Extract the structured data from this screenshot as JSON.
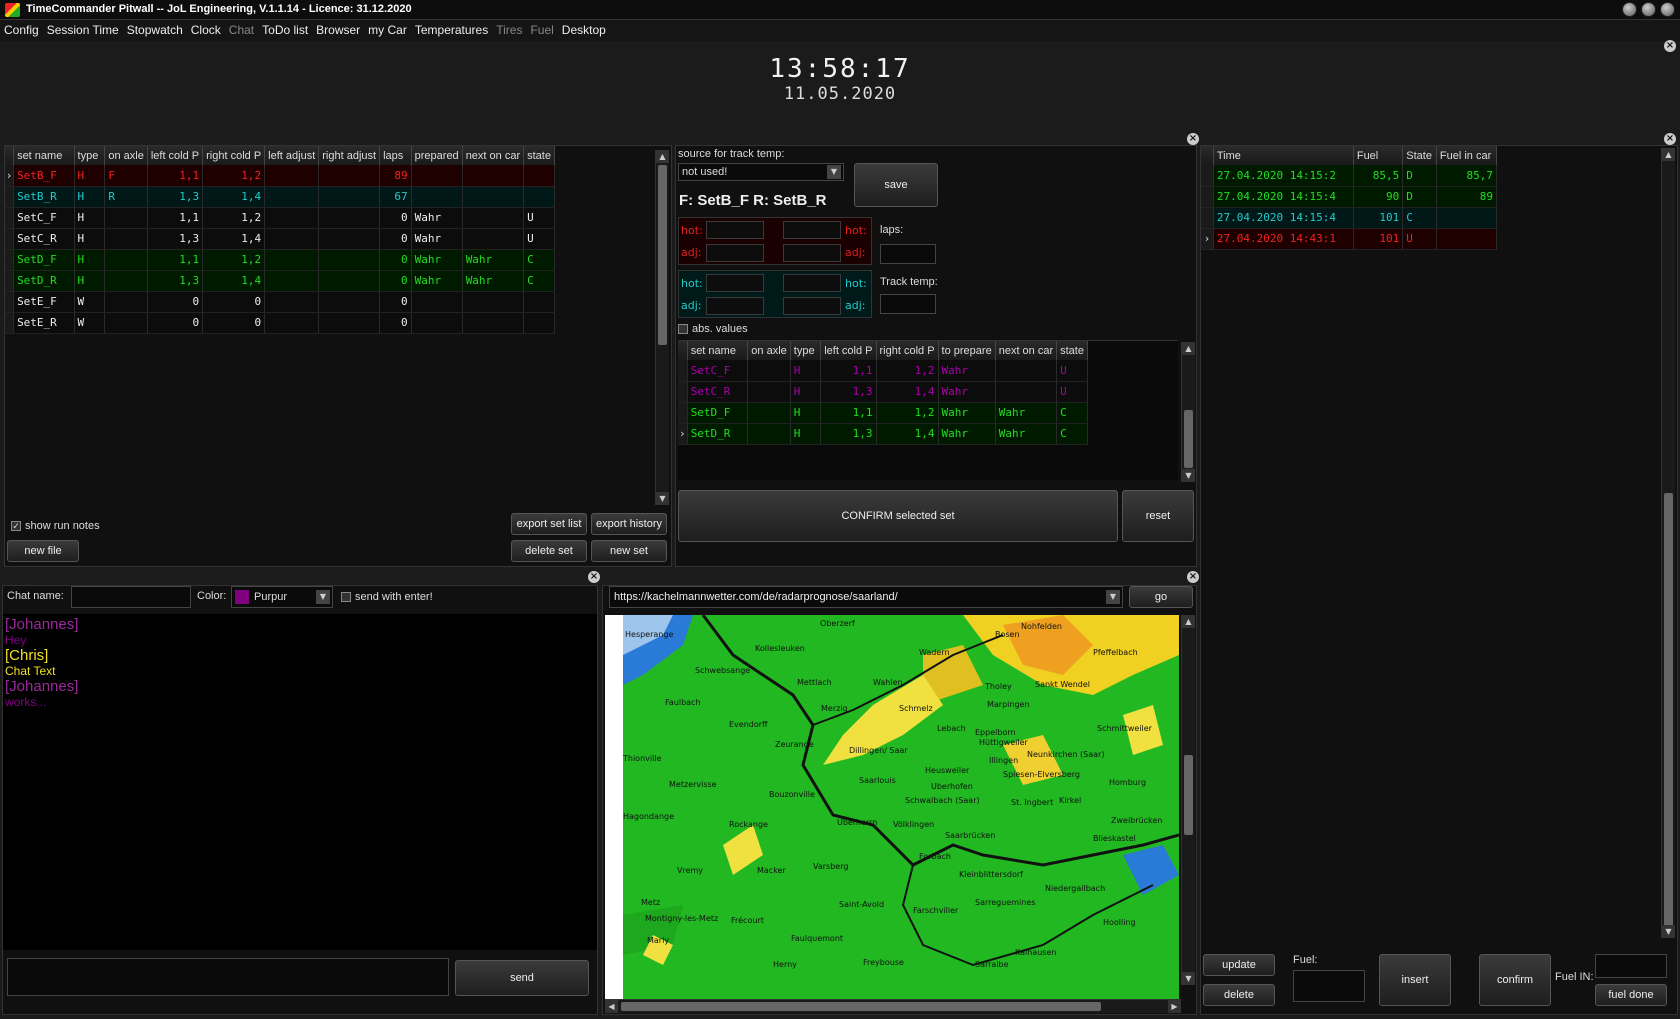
{
  "window": {
    "title": "TimeCommander Pitwall -- JoL Engineering, V.1.1.14 - Licence: 31.12.2020"
  },
  "menu": [
    {
      "label": "Config",
      "dim": false
    },
    {
      "label": "Session Time",
      "dim": false
    },
    {
      "label": "Stopwatch",
      "dim": false
    },
    {
      "label": "Clock",
      "dim": false
    },
    {
      "label": "Chat",
      "dim": true
    },
    {
      "label": "ToDo list",
      "dim": false
    },
    {
      "label": "Browser",
      "dim": false
    },
    {
      "label": "my Car",
      "dim": false
    },
    {
      "label": "Temperatures",
      "dim": false
    },
    {
      "label": "Tires",
      "dim": true
    },
    {
      "label": "Fuel",
      "dim": true
    },
    {
      "label": "Desktop",
      "dim": false
    }
  ],
  "clock": {
    "time": "13:58:17",
    "date": "11.05.2020"
  },
  "tiresets": {
    "columns": [
      "set name",
      "type",
      "on axle",
      "left cold P",
      "right cold P",
      "left adjust",
      "right adjust",
      "laps",
      "prepared",
      "next on car",
      "state"
    ],
    "rows": [
      {
        "sel": true,
        "color": "red",
        "cells": [
          "SetB_F",
          "H",
          "F",
          "1,1",
          "1,2",
          "",
          "",
          "89",
          "",
          "",
          ""
        ]
      },
      {
        "sel": false,
        "color": "cyan",
        "cells": [
          "SetB_R",
          "H",
          "R",
          "1,3",
          "1,4",
          "",
          "",
          "67",
          "",
          "",
          ""
        ]
      },
      {
        "sel": false,
        "color": "white",
        "cells": [
          "SetC_F",
          "H",
          "",
          "1,1",
          "1,2",
          "",
          "",
          "0",
          "Wahr",
          "",
          "U"
        ]
      },
      {
        "sel": false,
        "color": "white",
        "cells": [
          "SetC_R",
          "H",
          "",
          "1,3",
          "1,4",
          "",
          "",
          "0",
          "Wahr",
          "",
          "U"
        ]
      },
      {
        "sel": false,
        "color": "green",
        "cells": [
          "SetD_F",
          "H",
          "",
          "1,1",
          "1,2",
          "",
          "",
          "0",
          "Wahr",
          "Wahr",
          "C"
        ]
      },
      {
        "sel": false,
        "color": "green",
        "cells": [
          "SetD_R",
          "H",
          "",
          "1,3",
          "1,4",
          "",
          "",
          "0",
          "Wahr",
          "Wahr",
          "C"
        ]
      },
      {
        "sel": false,
        "color": "white",
        "cells": [
          "SetE_F",
          "W",
          "",
          "0",
          "0",
          "",
          "",
          "0",
          "",
          "",
          ""
        ]
      },
      {
        "sel": false,
        "color": "white",
        "cells": [
          "SetE_R",
          "W",
          "",
          "0",
          "0",
          "",
          "",
          "0",
          "",
          "",
          ""
        ]
      }
    ],
    "show_run_notes_label": "show run notes",
    "show_run_notes_checked": true,
    "buttons": {
      "export_set_list": "export set list",
      "export_history": "export history",
      "new_file": "new file",
      "delete_set": "delete set",
      "new_set": "new set"
    }
  },
  "track": {
    "source_label": "source for track temp:",
    "source_value": "not used!",
    "save_label": "save",
    "heading": "F: SetB_F R: SetB_R",
    "hot_label": "hot:",
    "adj_label": "adj:",
    "laps_label": "laps:",
    "track_temp_label": "Track temp:",
    "abs_values_label": "abs. values",
    "prep_columns": [
      "set name",
      "on axle",
      "type",
      "left cold P",
      "right cold P",
      "to prepare",
      "next on car",
      "state"
    ],
    "prep_rows": [
      {
        "sel": false,
        "color": "purple",
        "cells": [
          "SetC_F",
          "",
          "H",
          "1,1",
          "1,2",
          "Wahr",
          "",
          "U"
        ]
      },
      {
        "sel": false,
        "color": "purple",
        "cells": [
          "SetC_R",
          "",
          "H",
          "1,3",
          "1,4",
          "Wahr",
          "",
          "U"
        ]
      },
      {
        "sel": false,
        "color": "green",
        "cells": [
          "SetD_F",
          "",
          "H",
          "1,1",
          "1,2",
          "Wahr",
          "Wahr",
          "C"
        ]
      },
      {
        "sel": true,
        "color": "green",
        "cells": [
          "SetD_R",
          "",
          "H",
          "1,3",
          "1,4",
          "Wahr",
          "Wahr",
          "C"
        ]
      }
    ],
    "confirm_label": "CONFIRM selected set",
    "reset_label": "reset"
  },
  "fuel": {
    "columns": [
      "Time",
      "Fuel",
      "State",
      "Fuel in car"
    ],
    "rows": [
      {
        "sel": false,
        "color": "green",
        "cells": [
          "27.04.2020 14:15:2",
          "85,5",
          "D",
          "85,7"
        ]
      },
      {
        "sel": false,
        "color": "green",
        "cells": [
          "27.04.2020 14:15:4",
          "90",
          "D",
          "89"
        ]
      },
      {
        "sel": false,
        "color": "cyan",
        "cells": [
          "27.04.2020 14:15:4",
          "101",
          "C",
          ""
        ]
      },
      {
        "sel": true,
        "color": "red",
        "cells": [
          "27.04.2020 14:43:1",
          "101",
          "U",
          ""
        ]
      }
    ],
    "update_label": "update",
    "delete_label": "delete",
    "fuel_label": "Fuel:",
    "insert_label": "insert",
    "confirm_label": "confirm",
    "fuel_in_label": "Fuel IN:",
    "fuel_done_label": "fuel done"
  },
  "chat": {
    "name_label": "Chat name:",
    "color_label": "Color:",
    "color_value": "Purpur",
    "color_swatch": "#800080",
    "send_enter_label": "send with enter!",
    "messages": [
      {
        "text": "[Johannes]",
        "color": "#9a2a9a",
        "big": true
      },
      {
        "text": "Hey",
        "color": "#800080",
        "big": false
      },
      {
        "text": "[Chris]",
        "color": "#f0e020",
        "big": true
      },
      {
        "text": "Chat Text",
        "color": "#f0e020",
        "big": false
      },
      {
        "text": "[Johannes]",
        "color": "#9a2a9a",
        "big": true
      },
      {
        "text": "works...",
        "color": "#800080",
        "big": false
      }
    ],
    "send_label": "send"
  },
  "browser": {
    "url": "https://kachelmannwetter.com/de/radarprognose/saarland/",
    "go_label": "go",
    "map_labels": [
      {
        "t": "Hesperange"
      },
      {
        "t": "Oberzerf"
      },
      {
        "t": "Nohfelden"
      },
      {
        "t": "Kollesleuken"
      },
      {
        "t": "Wadern"
      },
      {
        "t": "Bosen"
      },
      {
        "t": "Pfeffelbach"
      },
      {
        "t": "Schwebsange"
      },
      {
        "t": "Mettlach"
      },
      {
        "t": "Wahlen"
      },
      {
        "t": "Tholey"
      },
      {
        "t": "Sankt Wendel"
      },
      {
        "t": "Faulbach"
      },
      {
        "t": "Merzig"
      },
      {
        "t": "Schmelz"
      },
      {
        "t": "Marpingen"
      },
      {
        "t": "Evendorff"
      },
      {
        "t": "Lebach"
      },
      {
        "t": "Eppelborn"
      },
      {
        "t": "Schmittweiler"
      },
      {
        "t": "Zeurange"
      },
      {
        "t": "Hüttigweiler"
      },
      {
        "t": "Thionville"
      },
      {
        "t": "Dillingen/ Saar"
      },
      {
        "t": "Neunkirchen (Saar)"
      },
      {
        "t": "Illingen"
      },
      {
        "t": "Heusweiler"
      },
      {
        "t": "Metzervisse"
      },
      {
        "t": "Saarlouis"
      },
      {
        "t": "Uberhofen"
      },
      {
        "t": "Spiesen-Elversberg"
      },
      {
        "t": "Homburg"
      },
      {
        "t": "Bouzonville"
      },
      {
        "t": "Schwalbach (Saar)"
      },
      {
        "t": "St. Ingbert"
      },
      {
        "t": "Kirkel"
      },
      {
        "t": "Hagondange"
      },
      {
        "t": "Rockange"
      },
      {
        "t": "Uberherrn"
      },
      {
        "t": "Völklingen"
      },
      {
        "t": "Zweibrücken"
      },
      {
        "t": "Saarbrücken"
      },
      {
        "t": "Blieskastel"
      },
      {
        "t": "Forbach"
      },
      {
        "t": "Vremy"
      },
      {
        "t": "Macker"
      },
      {
        "t": "Varsberg"
      },
      {
        "t": "Kleinblittersdorf"
      },
      {
        "t": "Niedergailbach"
      },
      {
        "t": "Metz"
      },
      {
        "t": "Saint-Avold"
      },
      {
        "t": "Sarreguemines"
      },
      {
        "t": "Montigny-les-Metz"
      },
      {
        "t": "Farschviller"
      },
      {
        "t": "Frécourt"
      },
      {
        "t": "Hoolling"
      },
      {
        "t": "Faulquemont"
      },
      {
        "t": "Marly"
      },
      {
        "t": "Kalhausen"
      },
      {
        "t": "Herny"
      },
      {
        "t": "Freybouse"
      },
      {
        "t": "Sarralbe"
      }
    ]
  }
}
